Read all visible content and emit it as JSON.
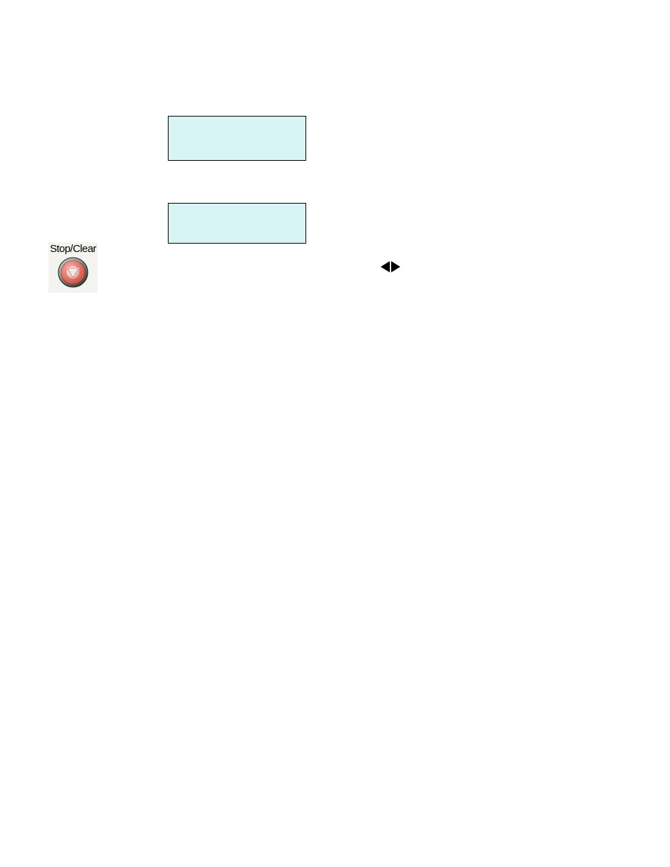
{
  "stopclear": {
    "label": "Stop/Clear"
  }
}
